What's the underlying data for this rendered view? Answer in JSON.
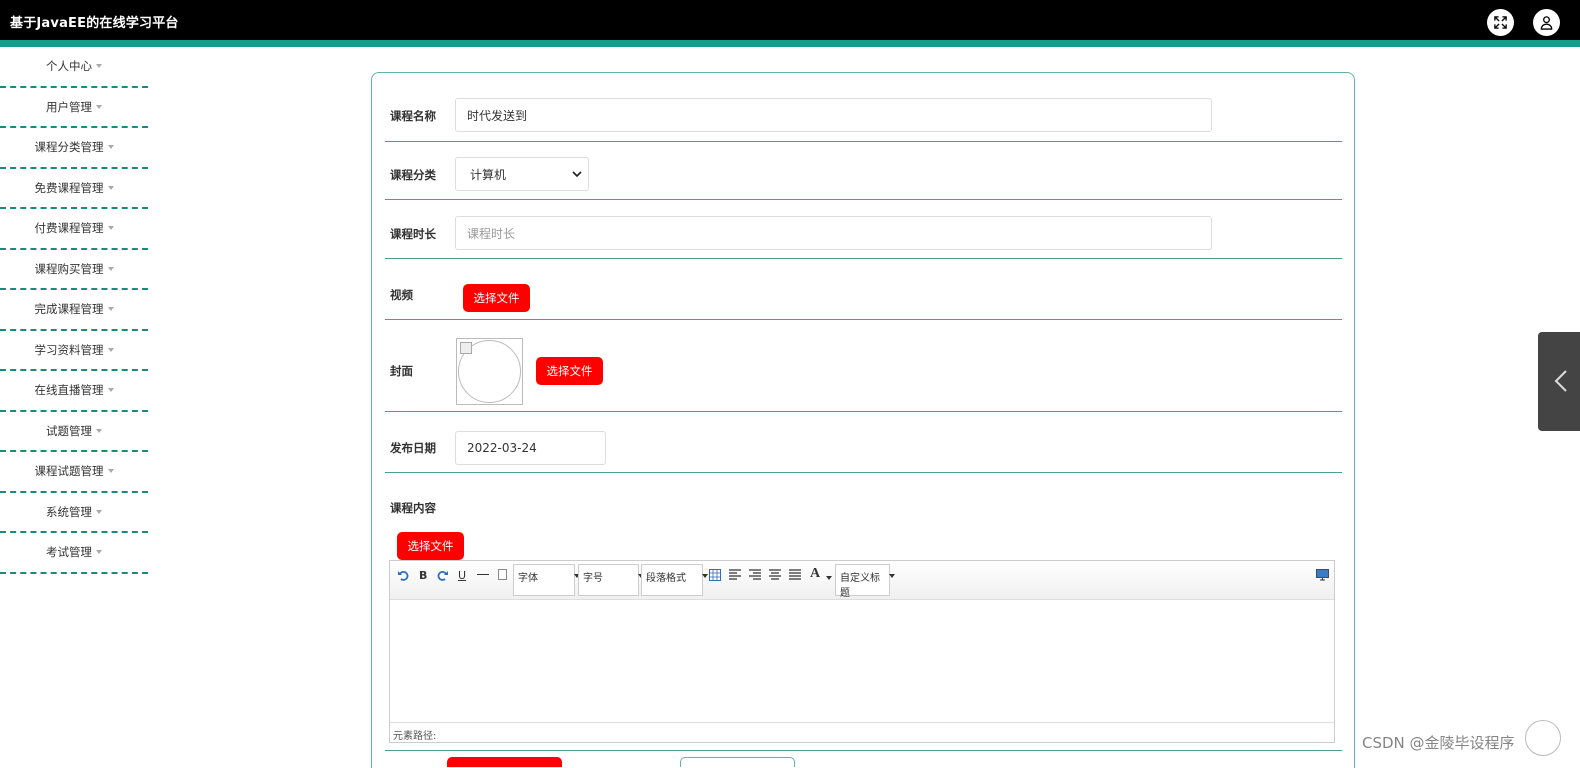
{
  "header": {
    "title": "基于JavaEE的在线学习平台",
    "icons": [
      "fullscreen-icon",
      "user-icon"
    ]
  },
  "sidebar": {
    "items": [
      {
        "label": "个人中心"
      },
      {
        "label": "用户管理"
      },
      {
        "label": "课程分类管理"
      },
      {
        "label": "免费课程管理"
      },
      {
        "label": "付费课程管理"
      },
      {
        "label": "课程购买管理"
      },
      {
        "label": "完成课程管理"
      },
      {
        "label": "学习资料管理"
      },
      {
        "label": "在线直播管理"
      },
      {
        "label": "试题管理"
      },
      {
        "label": "课程试题管理"
      },
      {
        "label": "系统管理"
      },
      {
        "label": "考试管理"
      }
    ]
  },
  "form": {
    "course_name": {
      "label": "课程名称",
      "value": "时代发送到"
    },
    "category": {
      "label": "课程分类",
      "selected": "计算机"
    },
    "duration": {
      "label": "课程时长",
      "placeholder": "课程时长"
    },
    "video": {
      "label": "视频",
      "button": "选择文件"
    },
    "cover": {
      "label": "封面",
      "button": "选择文件"
    },
    "publish_date": {
      "label": "发布日期",
      "value": "2022-03-24"
    },
    "content": {
      "label": "课程内容",
      "button": "选择文件"
    }
  },
  "editor": {
    "bold": "B",
    "underline": "U",
    "font_family": "字体",
    "font_size": "字号",
    "paragraph": "段落格式",
    "font_color": "A",
    "custom_title": "自定义标题",
    "status_path": "元素路径:"
  },
  "watermark": "CSDN @金陵毕设程序",
  "colors": {
    "topbar": "#000000",
    "accent": "#1a9a8c",
    "button_red": "#ff0000",
    "divider": "#4a9e93"
  }
}
